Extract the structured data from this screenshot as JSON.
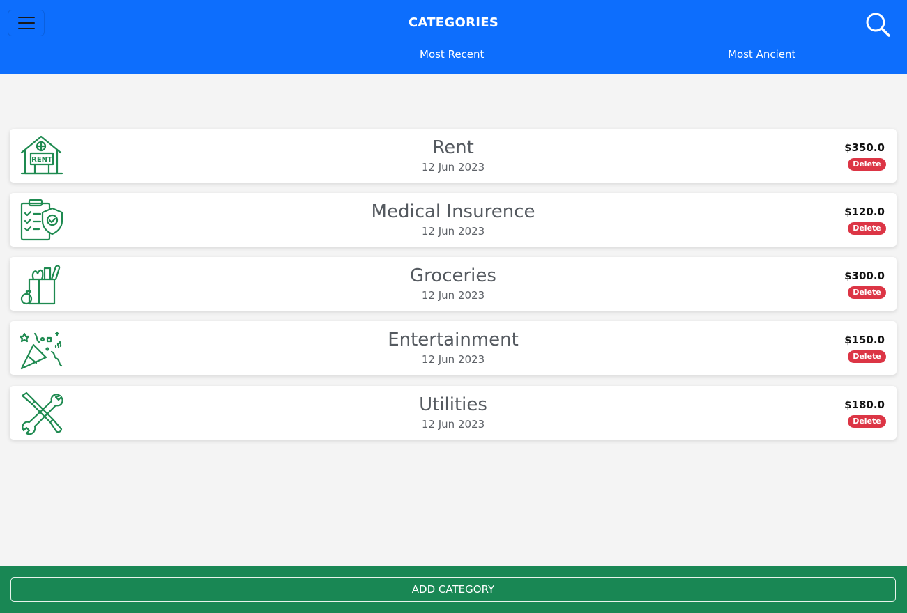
{
  "header": {
    "title": "CATEGORIES",
    "tabs": {
      "recent": "Most Recent",
      "ancient": "Most Ancient"
    },
    "menu_icon": "hamburger-menu-icon",
    "search_icon": "search-icon",
    "brand_color": "#0d6efd"
  },
  "categories": [
    {
      "name": "Rent",
      "date": "12 Jun 2023",
      "amount": "$350.0",
      "delete_label": "Delete",
      "icon": "house-rent-icon"
    },
    {
      "name": "Medical Insurence",
      "date": "12 Jun 2023",
      "amount": "$120.0",
      "delete_label": "Delete",
      "icon": "medical-clipboard-shield-icon"
    },
    {
      "name": "Groceries",
      "date": "12 Jun 2023",
      "amount": "$300.0",
      "delete_label": "Delete",
      "icon": "grocery-bag-icon"
    },
    {
      "name": "Entertainment",
      "date": "12 Jun 2023",
      "amount": "$150.0",
      "delete_label": "Delete",
      "icon": "party-popper-icon"
    },
    {
      "name": "Utilities",
      "date": "12 Jun 2023",
      "amount": "$180.0",
      "delete_label": "Delete",
      "icon": "wrench-screwdriver-icon"
    }
  ],
  "footer": {
    "add_label": "ADD CATEGORY",
    "color": "#198754"
  },
  "colors": {
    "icon_green": "#1e8a50",
    "delete_red": "#dc3545"
  }
}
